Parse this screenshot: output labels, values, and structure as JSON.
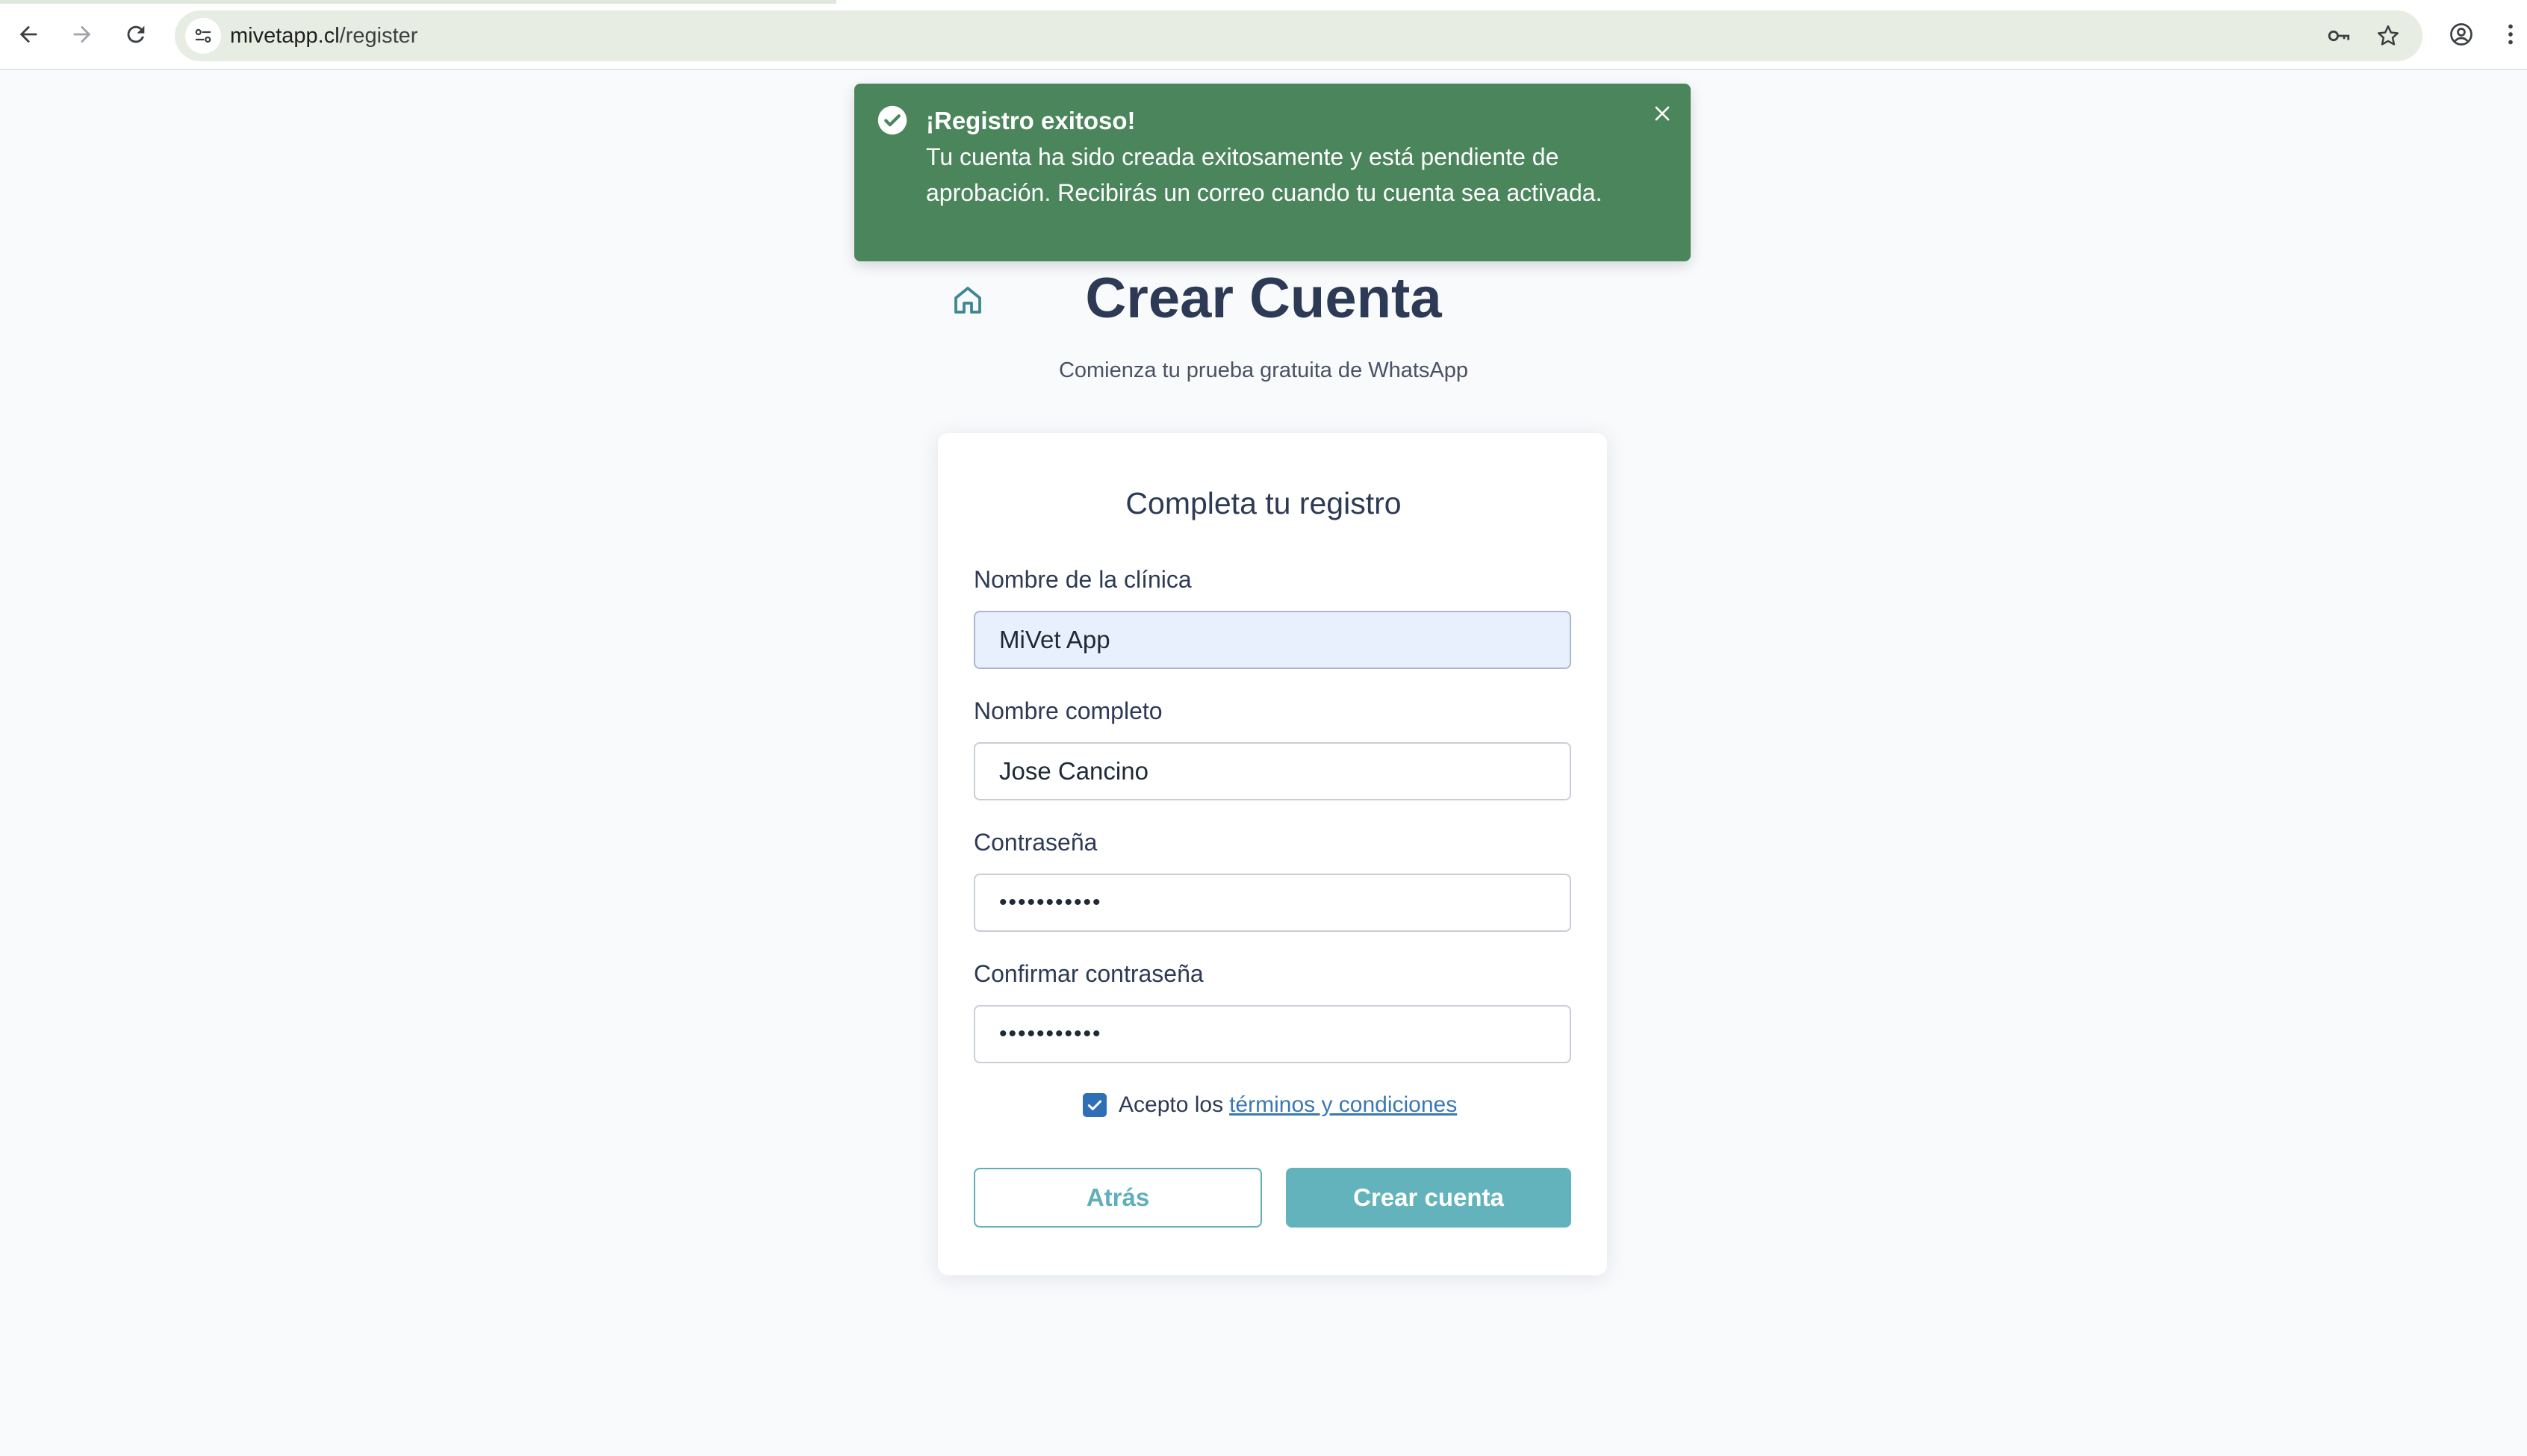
{
  "browser": {
    "url_host": "mivetapp.cl",
    "url_path": "/register",
    "icons": [
      "back-arrow-icon",
      "forward-arrow-icon",
      "reload-icon",
      "site-settings-icon",
      "password-key-icon",
      "bookmark-star-icon",
      "profile-icon",
      "menu-dots-icon"
    ]
  },
  "toast": {
    "title": "¡Registro exitoso!",
    "message": "Tu cuenta ha sido creada exitosamente y está pendiente de aprobación. Recibirás un correo cuando tu cuenta sea activada.",
    "color": "#4a855c"
  },
  "header": {
    "title": "Crear Cuenta",
    "subtitle": "Comienza tu prueba gratuita de WhatsApp"
  },
  "form": {
    "title": "Completa tu registro",
    "clinic_label": "Nombre de la clínica",
    "clinic_value": "MiVet App",
    "name_label": "Nombre completo",
    "name_value": "Jose Cancino",
    "password_label": "Contraseña",
    "password_value": "•••••••••••",
    "confirm_label": "Confirmar contraseña",
    "confirm_value": "•••••••••••",
    "terms_prefix": "Acepto los",
    "terms_link": "términos y condiciones",
    "terms_checked": true,
    "back_label": "Atrás",
    "create_label": "Crear cuenta",
    "accent_color": "#63b3bd"
  }
}
